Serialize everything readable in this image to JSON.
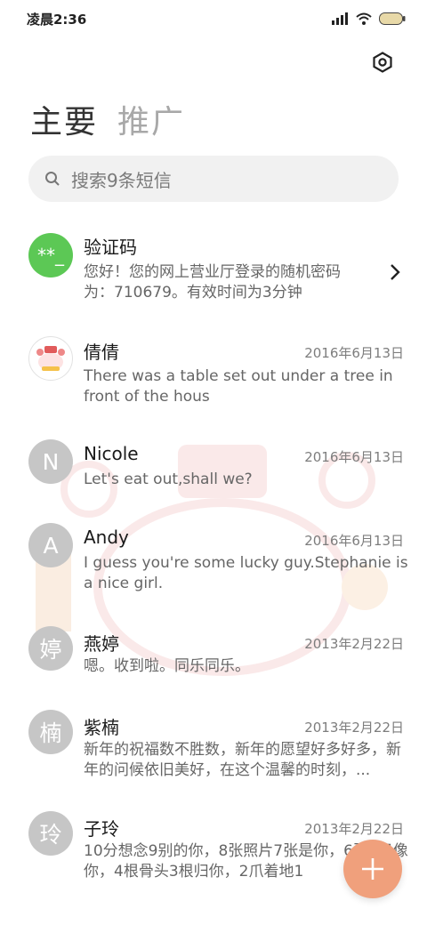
{
  "status_bar": {
    "time": "凌晨2:36"
  },
  "tabs": [
    {
      "label": "主要"
    },
    {
      "label": "推广"
    }
  ],
  "search": {
    "placeholder": "搜索9条短信"
  },
  "messages": [
    {
      "avatar_text": "**_",
      "name": "验证码",
      "date": "",
      "preview": "您好！您的网上营业厅登录的随机密码为：710679。有效时间为3分钟"
    },
    {
      "avatar_text": "",
      "name": "倩倩",
      "date": "2016年6月13日",
      "preview": "There was a table set out under a tree in front of the hous"
    },
    {
      "avatar_text": "N",
      "name": "Nicole",
      "date": "2016年6月13日",
      "preview": "Let's eat out,shall we?"
    },
    {
      "avatar_text": "A",
      "name": "Andy",
      "date": "2016年6月13日",
      "preview": "I guess you're some lucky guy.Stephanie is a nice girl."
    },
    {
      "avatar_text": "婷",
      "name": "燕婷",
      "date": "2013年2月22日",
      "preview": "嗯。收到啦。同乐同乐。"
    },
    {
      "avatar_text": "楠",
      "name": "紫楠",
      "date": "2013年2月22日",
      "preview": "新年的祝福数不胜数，新年的愿望好多好多，新年的问候依旧美好，在这个温馨的时刻，..."
    },
    {
      "avatar_text": "玲",
      "name": "子玲",
      "date": "2013年2月22日",
      "preview": "10分想念9别的你，8张照片7张是你，6张5只像你，4根骨头3根归你，2爪着地1"
    }
  ],
  "colors": {
    "verify_avatar": "#5cc855",
    "fab": "#f0a07c",
    "avatar_gray": "#c6c6c6"
  },
  "icons": {
    "settings": "settings-icon",
    "search": "search-icon",
    "chevron": "chevron-right-icon",
    "fab": "plus-icon"
  }
}
